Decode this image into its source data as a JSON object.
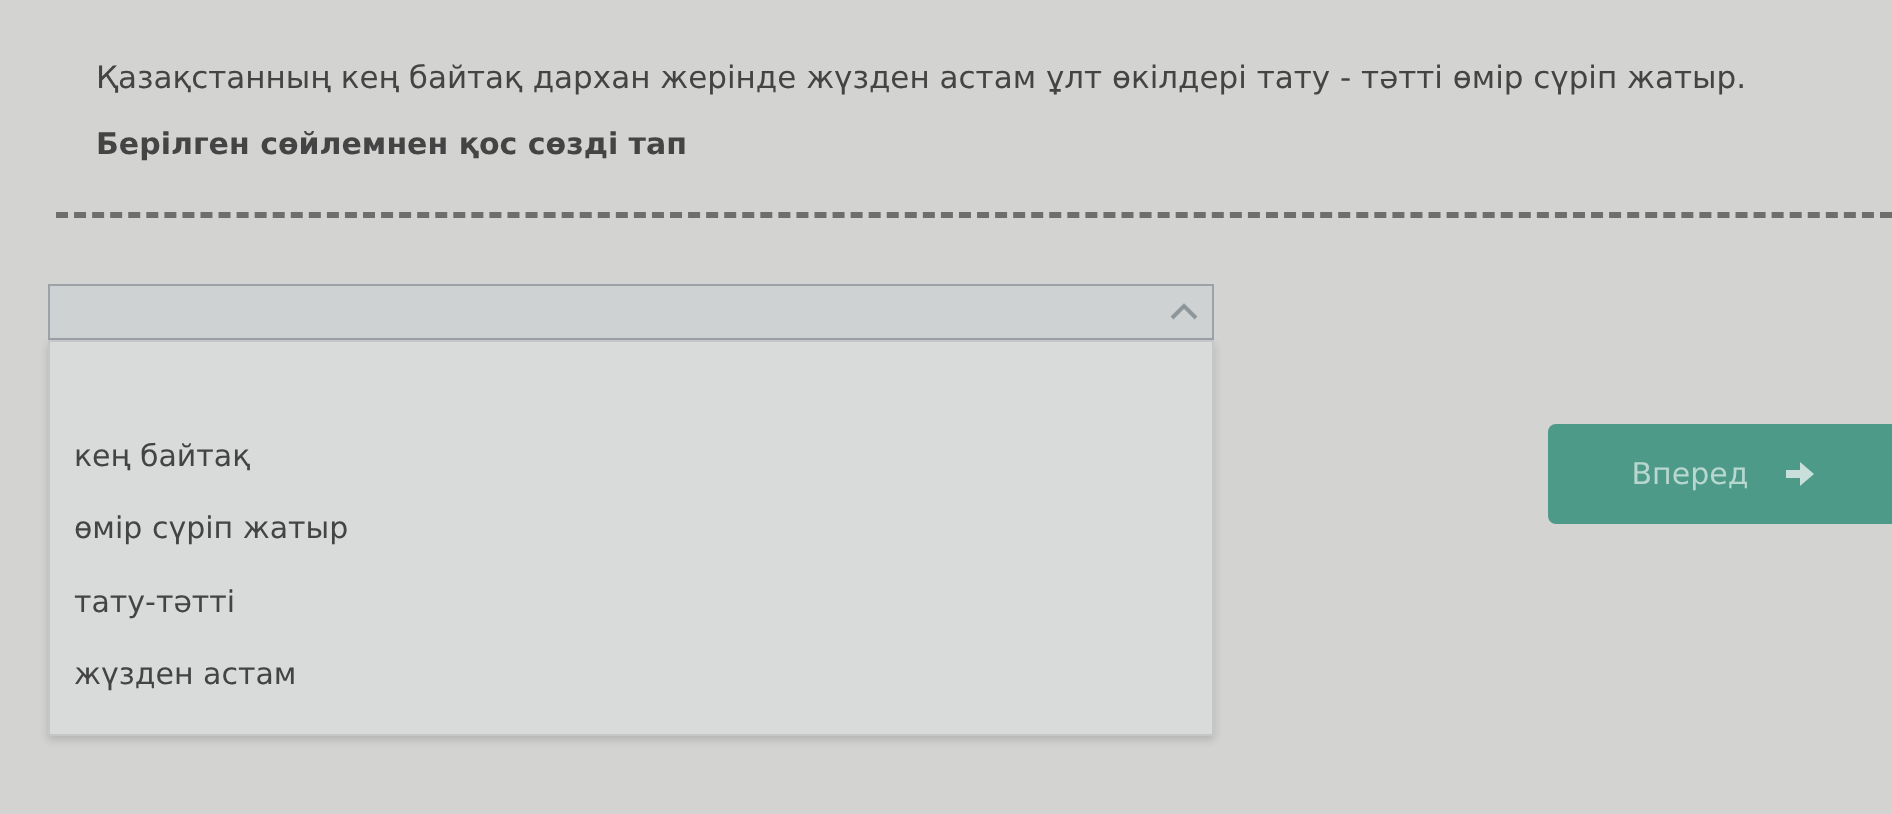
{
  "question": {
    "sentence": "Қазақстанның кең байтақ дархан жерінде жүзден астам ұлт өкілдері тату - тәтті өмір сүріп жатыр.",
    "instruction": "Берілген сөйлемнен қос сөзді тап"
  },
  "dropdown": {
    "expanded": true,
    "options": [
      {
        "label": "кең байтақ",
        "selected": false
      },
      {
        "label": "өмір сүріп жатыр",
        "selected": false
      },
      {
        "label": "тату-тәтті",
        "selected": false
      },
      {
        "label": "жүзден астам",
        "selected": false
      }
    ]
  },
  "next_button": {
    "label": "Вперед"
  }
}
